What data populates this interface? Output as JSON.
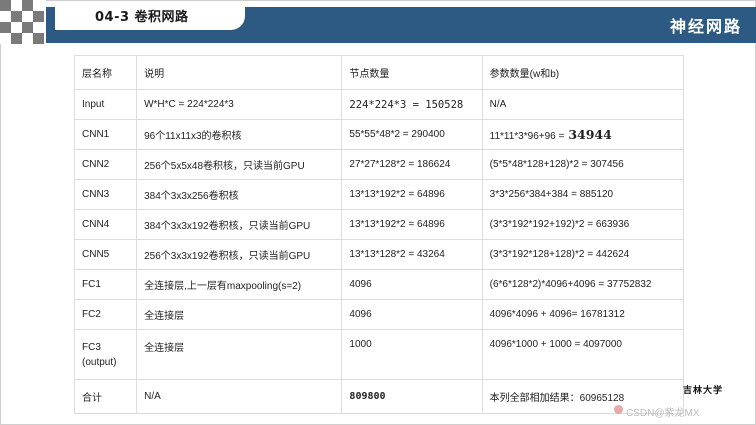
{
  "header": {
    "title": "04-3 卷积网路",
    "brand": "神经网路"
  },
  "table": {
    "columns": [
      "层名称",
      "说明",
      "节点数量",
      "参数数量(w和b)"
    ],
    "rows": [
      {
        "layer": "Input",
        "desc": "W*H*C = 224*224*3",
        "nodes": "224*224*3 = 150528",
        "params": "N/A"
      },
      {
        "layer": "CNN1",
        "desc": "96个11x11x3的卷积核",
        "nodes": "55*55*48*2 = 290400",
        "params": "11*11*3*96+96 =",
        "params_extra": "34944"
      },
      {
        "layer": "CNN2",
        "desc": "256个5x5x48卷积核，只读当前GPU",
        "nodes": "27*27*128*2 = 186624",
        "params": "(5*5*48*128+128)*2 = 307456"
      },
      {
        "layer": "CNN3",
        "desc": "384个3x3x256卷积核",
        "nodes": "13*13*192*2 = 64896",
        "params": "3*3*256*384+384 = 885120"
      },
      {
        "layer": "CNN4",
        "desc": "384个3x3x192卷积核，只读当前GPU",
        "nodes": "13*13*192*2 = 64896",
        "params": "(3*3*192*192+192)*2 = 663936"
      },
      {
        "layer": "CNN5",
        "desc": "256个3x3x192卷积核，只读当前GPU",
        "nodes": "13*13*128*2 = 43264",
        "params": "(3*3*192*128+128)*2 = 442624"
      },
      {
        "layer": "FC1",
        "desc": "全连接层,上一层有maxpooling(s=2)",
        "nodes": "4096",
        "params": "(6*6*128*2)*4096+4096 = 37752832"
      },
      {
        "layer": "FC2",
        "desc": "全连接层",
        "nodes": "4096",
        "params": "4096*4096  + 4096= 16781312"
      },
      {
        "layer": "FC3\n(output)",
        "desc": "全连接层",
        "nodes": "1000",
        "params": "4096*1000 + 1000 = 4097000"
      },
      {
        "layer": "合计",
        "desc": "N/A",
        "nodes": "809800",
        "params": "本列全部相加结果：60965128"
      }
    ]
  },
  "footer": {
    "logo_text": "吉林大学",
    "watermark": "CSDN@紫龙MX"
  },
  "colors": {
    "header_bar": "#2d5a83",
    "checker_dark": "#7a7a7a",
    "border": "#dcdcdc"
  }
}
